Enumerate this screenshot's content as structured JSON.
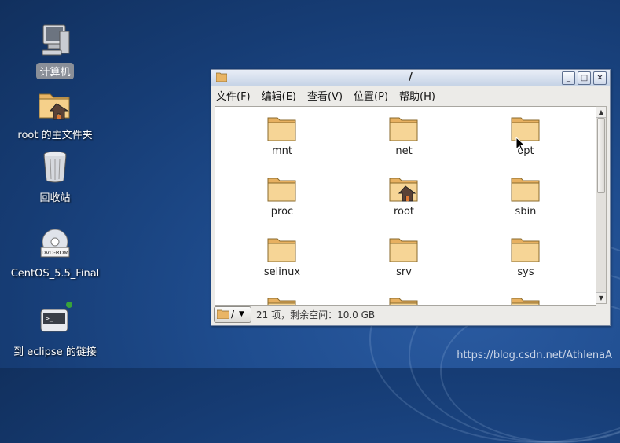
{
  "desktop": {
    "icons": [
      {
        "label": "计算机",
        "icon": "computer-icon",
        "selected": true
      },
      {
        "label": "root 的主文件夹",
        "icon": "home-folder-icon"
      },
      {
        "label": "回收站",
        "icon": "trash-icon"
      },
      {
        "label": "CentOS_5.5_Final",
        "icon": "dvd-rom-icon",
        "disc_label": "DVD-ROM"
      },
      {
        "label": "到 eclipse 的链接",
        "icon": "eclipse-launcher-icon"
      }
    ],
    "watermark": "https://blog.csdn.net/AthlenaA"
  },
  "window": {
    "title": "/",
    "menus": [
      "文件(F)",
      "编辑(E)",
      "查看(V)",
      "位置(P)",
      "帮助(H)"
    ],
    "controls": {
      "minimize": "_",
      "maximize": "□",
      "close": "✕"
    },
    "files": [
      {
        "name": "mnt",
        "icon": "folder-icon"
      },
      {
        "name": "net",
        "icon": "folder-icon"
      },
      {
        "name": "opt",
        "icon": "folder-icon"
      },
      {
        "name": "proc",
        "icon": "folder-icon"
      },
      {
        "name": "root",
        "icon": "home-folder-icon"
      },
      {
        "name": "sbin",
        "icon": "folder-icon"
      },
      {
        "name": "selinux",
        "icon": "folder-icon"
      },
      {
        "name": "srv",
        "icon": "folder-icon"
      },
      {
        "name": "sys",
        "icon": "folder-icon"
      }
    ],
    "path_button": "/",
    "status": "21 项，剩余空间：10.0 GB",
    "scroll_position": 0.0
  }
}
